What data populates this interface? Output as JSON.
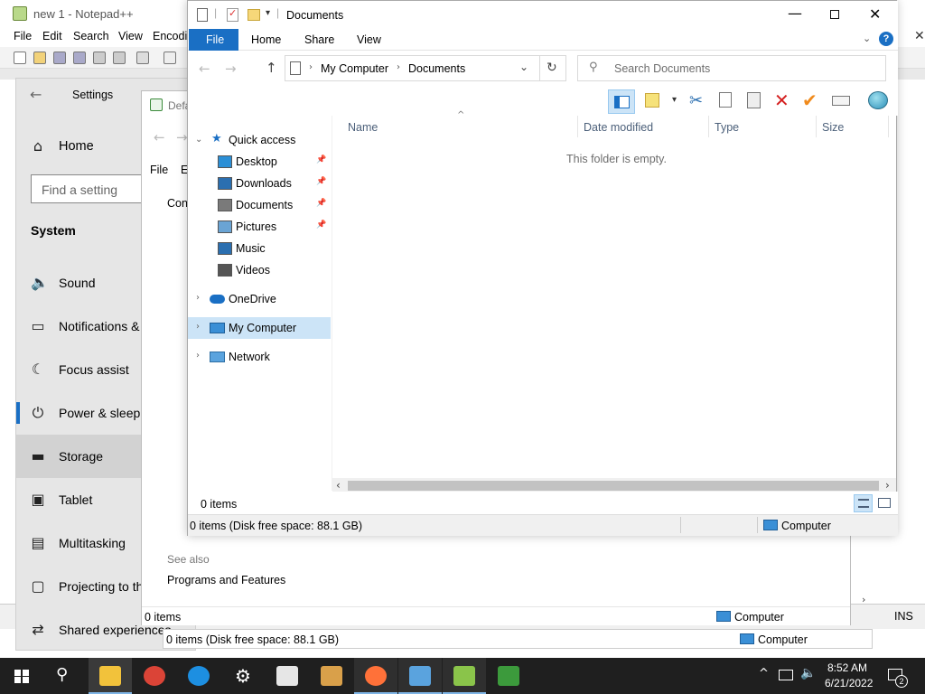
{
  "notepad": {
    "title": "new 1 - Notepad++",
    "menu": [
      "File",
      "Edit",
      "Search",
      "View",
      "Encodi"
    ],
    "status_ins": "INS"
  },
  "settings": {
    "title": "Settings",
    "home": "Home",
    "search_placeholder": "Find a setting",
    "section": "System",
    "items": [
      {
        "label": "Sound",
        "icon": "speaker-icon"
      },
      {
        "label": "Notifications &",
        "icon": "notification-icon"
      },
      {
        "label": "Focus assist",
        "icon": "moon-icon"
      },
      {
        "label": "Power & sleep",
        "icon": "power-icon"
      },
      {
        "label": "Storage",
        "icon": "storage-icon"
      },
      {
        "label": "Tablet",
        "icon": "tablet-icon"
      },
      {
        "label": "Multitasking",
        "icon": "multitasking-icon"
      },
      {
        "label": "Projecting to th",
        "icon": "projecting-icon"
      },
      {
        "label": "Shared experiences",
        "icon": "shared-icon"
      }
    ],
    "selected_index": 4
  },
  "default_programs": {
    "title": "Defa",
    "menu": [
      "File",
      "E"
    ],
    "content_label": "Con",
    "see_also": "See also",
    "programs_link": "Programs and Features",
    "items_count": "0 items",
    "computer": "Computer",
    "status_space": "0 items (Disk free space: 88.1 GB)",
    "status_computer": "Computer"
  },
  "explorer": {
    "title": "Documents",
    "tabs": [
      "File",
      "Home",
      "Share",
      "View"
    ],
    "breadcrumb": [
      "My Computer",
      "Documents"
    ],
    "search_placeholder": "Search Documents",
    "columns": [
      "Name",
      "Date modified",
      "Type",
      "Size"
    ],
    "empty_message": "This folder is empty.",
    "quick_access": "Quick access",
    "nav_items": [
      {
        "label": "Desktop",
        "pinned": true
      },
      {
        "label": "Downloads",
        "pinned": true
      },
      {
        "label": "Documents",
        "pinned": true
      },
      {
        "label": "Pictures",
        "pinned": true
      },
      {
        "label": "Music",
        "pinned": false
      },
      {
        "label": "Videos",
        "pinned": false
      }
    ],
    "onedrive": "OneDrive",
    "my_computer": "My Computer",
    "network": "Network",
    "item_count": "0 items",
    "status_space": "0 items (Disk free space: 88.1 GB)",
    "status_computer": "Computer",
    "colors": {
      "accent": "#1a6fc4",
      "selected": "#cce4f7"
    }
  },
  "taskbar": {
    "time": "8:52 AM",
    "date": "6/21/2022",
    "notification_count": "2",
    "apps": [
      "file-explorer-icon",
      "chrome-icon",
      "edge-icon",
      "settings-icon",
      "7zip-icon",
      "paint-icon",
      "firefox-icon",
      "control-panel-icon",
      "notepadpp-icon",
      "frog-icon"
    ]
  }
}
